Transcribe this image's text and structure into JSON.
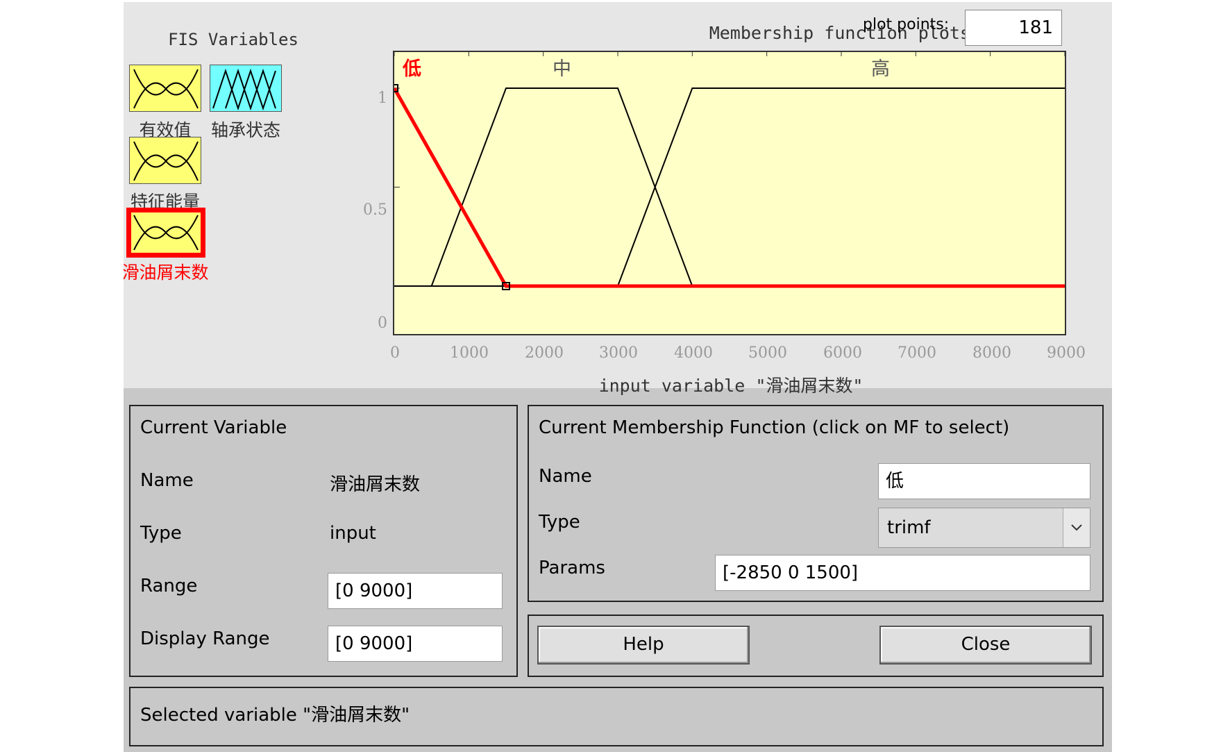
{
  "fis_variables": {
    "title": "FIS Variables",
    "items": [
      {
        "label": "有效值",
        "kind": "input",
        "color": "#ffff73",
        "selected": false
      },
      {
        "label": "轴承状态",
        "kind": "output",
        "color": "#73ffff",
        "selected": false
      },
      {
        "label": "特征能量",
        "kind": "input",
        "color": "#ffff73",
        "selected": false
      },
      {
        "label": "滑油屑末数",
        "kind": "input",
        "color": "#ffff73",
        "selected": true
      }
    ]
  },
  "plot": {
    "title": "Membership function plots",
    "plot_points_label": "plot points:",
    "plot_points_value": "181"
  },
  "chart_data": {
    "type": "line",
    "title": "",
    "xlabel": "input variable \"滑油屑末数\"",
    "ylabel": "",
    "xlim": [
      0,
      9000
    ],
    "ylim": [
      0,
      1
    ],
    "x_ticks": [
      "0",
      "1000",
      "2000",
      "3000",
      "4000",
      "5000",
      "6000",
      "7000",
      "8000",
      "9000"
    ],
    "y_ticks": [
      "0",
      "0.5",
      "1"
    ],
    "grid": false,
    "series": [
      {
        "name": "低",
        "type": "trimf",
        "x": [
          0,
          0,
          1500,
          9000
        ],
        "y": [
          1,
          1,
          0,
          0
        ],
        "selected": true,
        "color": "#ff0000"
      },
      {
        "name": "中",
        "type": "trapmf",
        "x": [
          0,
          500,
          1500,
          3000,
          4000,
          9000
        ],
        "y": [
          0,
          0,
          1,
          1,
          0,
          0
        ],
        "selected": false,
        "color": "#000000"
      },
      {
        "name": "高",
        "type": "trapmf",
        "x": [
          0,
          3000,
          4000,
          9000
        ],
        "y": [
          0,
          0,
          1,
          1
        ],
        "selected": false,
        "color": "#000000"
      }
    ]
  },
  "current_variable": {
    "title": "Current Variable",
    "name_label": "Name",
    "name_value": "滑油屑末数",
    "type_label": "Type",
    "type_value": "input",
    "range_label": "Range",
    "range_value": "[0 9000]",
    "display_range_label": "Display Range",
    "display_range_value": "[0 9000]"
  },
  "current_mf": {
    "title": "Current Membership Function (click on MF to select)",
    "name_label": "Name",
    "name_value": "低",
    "type_label": "Type",
    "type_value": "trimf",
    "params_label": "Params",
    "params_value": "[-2850 0 1500]"
  },
  "buttons": {
    "help_label": "Help",
    "close_label": "Close"
  },
  "status": {
    "text": "Selected variable \"滑油屑末数\""
  }
}
